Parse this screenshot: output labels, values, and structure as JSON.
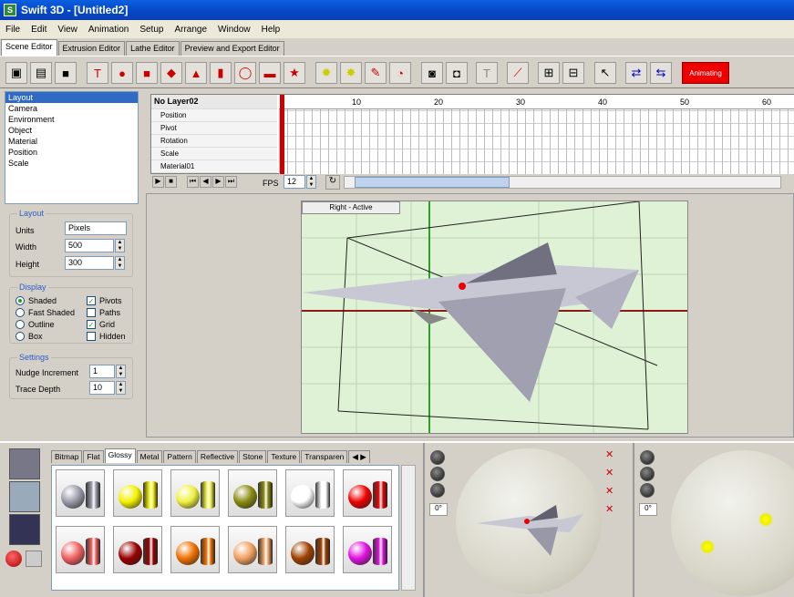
{
  "window": {
    "title": "Swift 3D - [Untitled2]"
  },
  "menu": [
    "File",
    "Edit",
    "View",
    "Animation",
    "Setup",
    "Arrange",
    "Window",
    "Help"
  ],
  "editor_tabs": [
    {
      "label": "Scene Editor",
      "active": true
    },
    {
      "label": "Extrusion Editor",
      "active": false
    },
    {
      "label": "Lathe Editor",
      "active": false
    },
    {
      "label": "Preview and Export Editor",
      "active": false
    }
  ],
  "toolbar": {
    "animating_label": "Animating"
  },
  "property_list": [
    "Layout",
    "Camera",
    "Environment",
    "Object",
    "Material",
    "Position",
    "Scale"
  ],
  "layout": {
    "title": "Layout",
    "units_label": "Units",
    "units_value": "Pixels",
    "width_label": "Width",
    "width_value": "500",
    "height_label": "Height",
    "height_value": "300"
  },
  "display": {
    "title": "Display",
    "shaded": "Shaded",
    "fast_shaded": "Fast Shaded",
    "outline": "Outline",
    "box": "Box",
    "pivots": "Pivots",
    "paths": "Paths",
    "grid": "Grid",
    "hidden": "Hidden"
  },
  "settings": {
    "title": "Settings",
    "nudge_label": "Nudge Increment",
    "nudge_value": "1",
    "trace_label": "Trace Depth",
    "trace_value": "10"
  },
  "timeline": {
    "layer": "No Layer02",
    "tracks": [
      "Position",
      "Pivot",
      "Rotation",
      "Scale",
      "Material01"
    ],
    "ticks": [
      "10",
      "20",
      "30",
      "40",
      "50",
      "60"
    ],
    "fps_label": "FPS",
    "fps_value": "12"
  },
  "viewport": {
    "title": "Right - Active"
  },
  "material_tabs": [
    "Bitmap",
    "Flat",
    "Glossy",
    "Metal",
    "Pattern",
    "Reflective",
    "Stone",
    "Texture",
    "Transparen"
  ],
  "light_angle_1": "0°",
  "light_angle_2": "0°",
  "swatch_colors": [
    "#9a9aa8",
    "#f2f200",
    "#f0f040",
    "#8a8a10",
    "#ffffff",
    "#ee0000",
    "#f06060",
    "#990000",
    "#f07000",
    "#f0a060",
    "#a04000",
    "#e010e0"
  ]
}
